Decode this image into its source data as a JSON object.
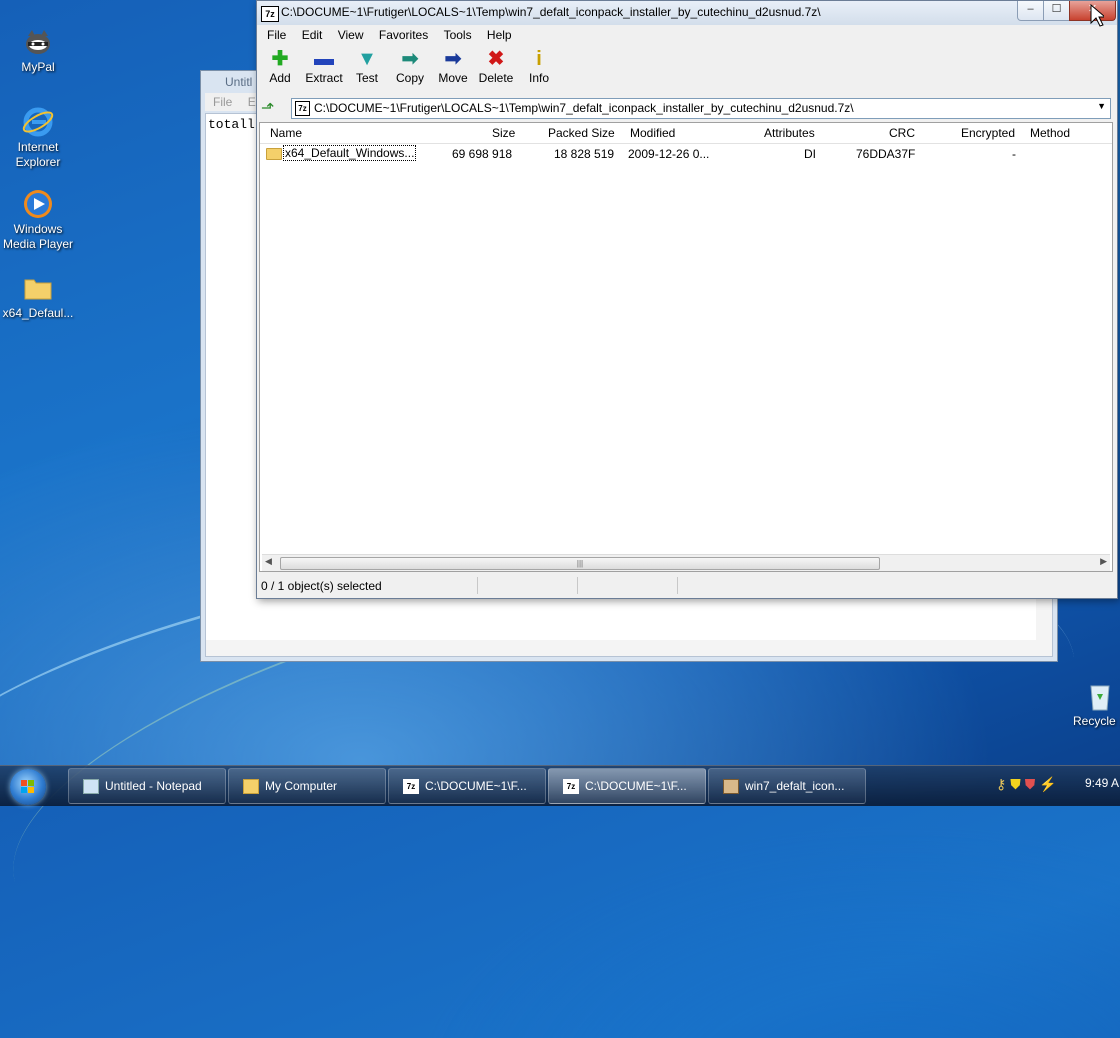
{
  "desktop": {
    "icons": [
      {
        "label": "MyPal",
        "icon": "mypal-raccoon-icon"
      },
      {
        "label": "Internet Explorer",
        "icon": "internet-explorer-icon"
      },
      {
        "label": "Windows Media Player",
        "icon": "media-player-icon"
      },
      {
        "label": "x64_Defaul...",
        "icon": "folder-icon"
      },
      {
        "label": "Recycle B",
        "icon": "recycle-bin-icon"
      }
    ]
  },
  "notepad": {
    "title": "Untitl",
    "menu": [
      "File",
      "E"
    ],
    "text": "totall"
  },
  "zip": {
    "title": "C:\\DOCUME~1\\Frutiger\\LOCALS~1\\Temp\\win7_defalt_iconpack_installer_by_cutechinu_d2usnud.7z\\",
    "app_icon_text": "7z",
    "menu": [
      "File",
      "Edit",
      "View",
      "Favorites",
      "Tools",
      "Help"
    ],
    "toolbar": [
      {
        "label": "Add",
        "icon": "plus-icon",
        "color": "#22aa22"
      },
      {
        "label": "Extract",
        "icon": "minus-icon",
        "color": "#2244bb"
      },
      {
        "label": "Test",
        "icon": "check-icon",
        "color": "#22a0a0"
      },
      {
        "label": "Copy",
        "icon": "copy-arrow-icon",
        "color": "#1d8a7a"
      },
      {
        "label": "Move",
        "icon": "move-arrow-icon",
        "color": "#1a3a9a"
      },
      {
        "label": "Delete",
        "icon": "delete-x-icon",
        "color": "#d01818"
      },
      {
        "label": "Info",
        "icon": "info-icon",
        "color": "#c8a000"
      }
    ],
    "address": "C:\\DOCUME~1\\Frutiger\\LOCALS~1\\Temp\\win7_defalt_iconpack_installer_by_cutechinu_d2usnud.7z\\",
    "columns": [
      "Name",
      "Size",
      "Packed Size",
      "Modified",
      "Attributes",
      "CRC",
      "Encrypted",
      "Method"
    ],
    "rows": [
      {
        "name": "x64_Default_Windows...",
        "size": "69 698 918",
        "packed": "18 828 519",
        "modified": "2009-12-26 0...",
        "attributes": "DI",
        "crc": "76DDA37F",
        "encrypted": "-",
        "method": ""
      }
    ],
    "status": "0 / 1 object(s) selected"
  },
  "taskbar": {
    "buttons": [
      {
        "label": "Untitled - Notepad",
        "active": false
      },
      {
        "label": "My Computer",
        "active": false
      },
      {
        "label": "C:\\DOCUME~1\\F...",
        "active": false
      },
      {
        "label": "C:\\DOCUME~1\\F...",
        "active": true
      },
      {
        "label": "win7_defalt_icon...",
        "active": false
      }
    ],
    "clock": "9:49 A"
  }
}
